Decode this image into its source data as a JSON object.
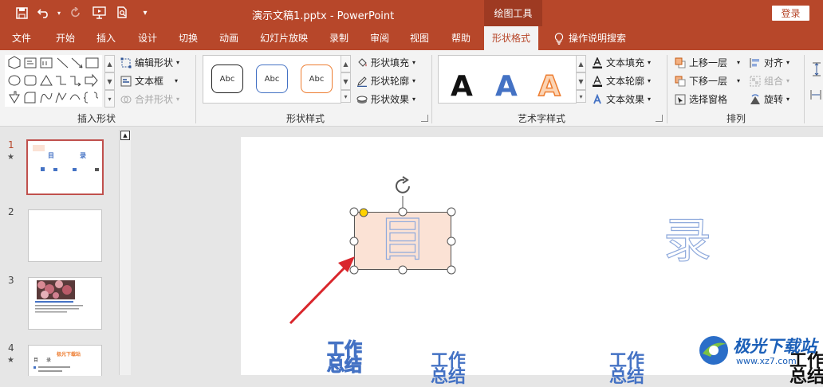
{
  "title_bar": {
    "document_title": "演示文稿1.pptx  -  PowerPoint",
    "context_tool": "绘图工具",
    "login": "登录",
    "quick_access": {
      "save_icon": "save-icon",
      "undo_icon": "undo-icon",
      "redo_icon": "redo-icon",
      "slideshow_icon": "present-from-beginning-icon",
      "preview_icon": "print-preview-icon",
      "customize_icon": "customize-qat-icon"
    }
  },
  "tabs": [
    "文件",
    "开始",
    "插入",
    "设计",
    "切换",
    "动画",
    "幻灯片放映",
    "录制",
    "审阅",
    "视图",
    "帮助",
    "形状格式",
    "操作说明搜索"
  ],
  "active_tab": "形状格式",
  "ribbon": {
    "insert_shapes": {
      "label": "插入形状",
      "edit_shape": "编辑形状",
      "text_box": "文本框",
      "merge_shapes": "合并形状"
    },
    "shape_styles": {
      "label": "形状样式",
      "thumb_text": "Abc",
      "fill": "形状填充",
      "outline": "形状轮廓",
      "effects": "形状效果",
      "thumb_colors": [
        "#222222",
        "#4472c4",
        "#ed7d31"
      ]
    },
    "wordart_styles": {
      "label": "艺术字样式",
      "sample": "A",
      "text_fill": "文本填充",
      "text_outline": "文本轮廓",
      "text_effects": "文本效果"
    },
    "arrange": {
      "label": "排列",
      "bring_forward": "上移一层",
      "send_backward": "下移一层",
      "selection_pane": "选择窗格",
      "align": "对齐",
      "group": "组合",
      "rotate": "旋转"
    }
  },
  "thumbnails": [
    {
      "number": "1",
      "has_star": true,
      "active": true,
      "text_a": "目",
      "text_b": "录"
    },
    {
      "number": "2",
      "has_star": false,
      "active": false
    },
    {
      "number": "3",
      "has_star": false,
      "active": false
    },
    {
      "number": "4",
      "has_star": true,
      "active": false,
      "header_text": "极光下载站",
      "text_a": "目",
      "text_b": "录"
    }
  ],
  "slide": {
    "selected_shape_text": "目",
    "right_text": "录",
    "item_texts": [
      "工作\n总结",
      "工作\n总结",
      "工作\n总结",
      "工作\n总结"
    ]
  },
  "watermark": {
    "text": "极光下载站",
    "url": "www.xz7.com"
  },
  "colors": {
    "accent": "#b7472a",
    "shape_fill": "#fbe2d5",
    "pattern_text": "#8faadc",
    "arrow": "#d9262c",
    "item_text": "#4472c4"
  }
}
